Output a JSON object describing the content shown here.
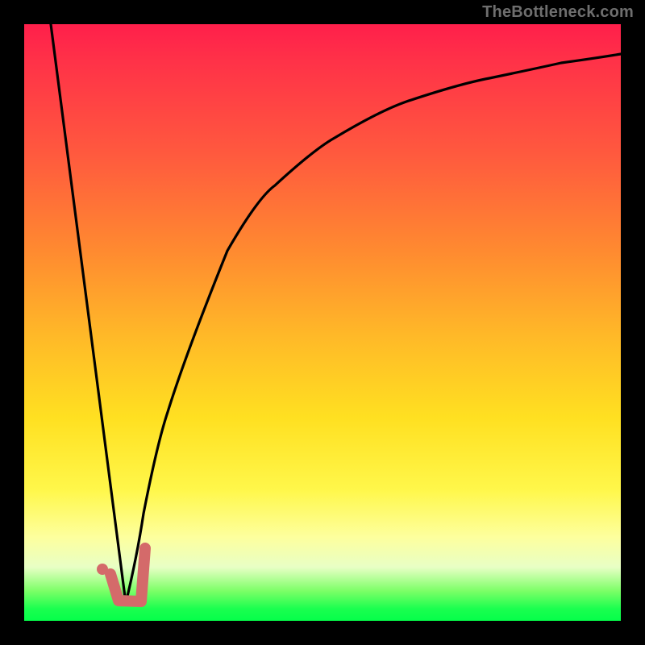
{
  "watermark": "TheBottleneck.com",
  "colors": {
    "gradient_top": "#ff1f4b",
    "gradient_bottom": "#05ff4a",
    "curve": "#000000",
    "marker": "#d46a6a",
    "frame": "#000000"
  },
  "chart_data": {
    "type": "line",
    "title": "",
    "xlabel": "",
    "ylabel": "",
    "xlim": [
      0,
      100
    ],
    "ylim": [
      0,
      100
    ],
    "note": "Axes are unlabeled in the image; x/y are normalized 0-100 across the plot area. y=0 is the bottom (green), y=100 is the top (red). Background color encodes bottleneck severity; green ≈ 0%, red ≈ 100%.",
    "series": [
      {
        "name": "falling-line",
        "description": "Straight segment from top-left down to the valley near x≈17.",
        "x": [
          4.5,
          17
        ],
        "y": [
          100,
          3
        ]
      },
      {
        "name": "rising-curve",
        "description": "Concave-increasing curve from the valley up toward the top-right corner.",
        "x": [
          17,
          20,
          24,
          28,
          34,
          42,
          52,
          64,
          78,
          90,
          100
        ],
        "y": [
          3,
          18,
          35,
          49,
          62,
          73,
          81,
          87,
          91,
          93.5,
          95
        ]
      }
    ],
    "annotations": [
      {
        "name": "valley-marker",
        "shape": "J-check",
        "approx_vertices_xy": [
          [
            14.5,
            7.8
          ],
          [
            15.8,
            3.4
          ],
          [
            19.6,
            3.2
          ],
          [
            20.3,
            12.2
          ]
        ],
        "dot_xy": [
          13.1,
          8.6
        ]
      }
    ]
  }
}
